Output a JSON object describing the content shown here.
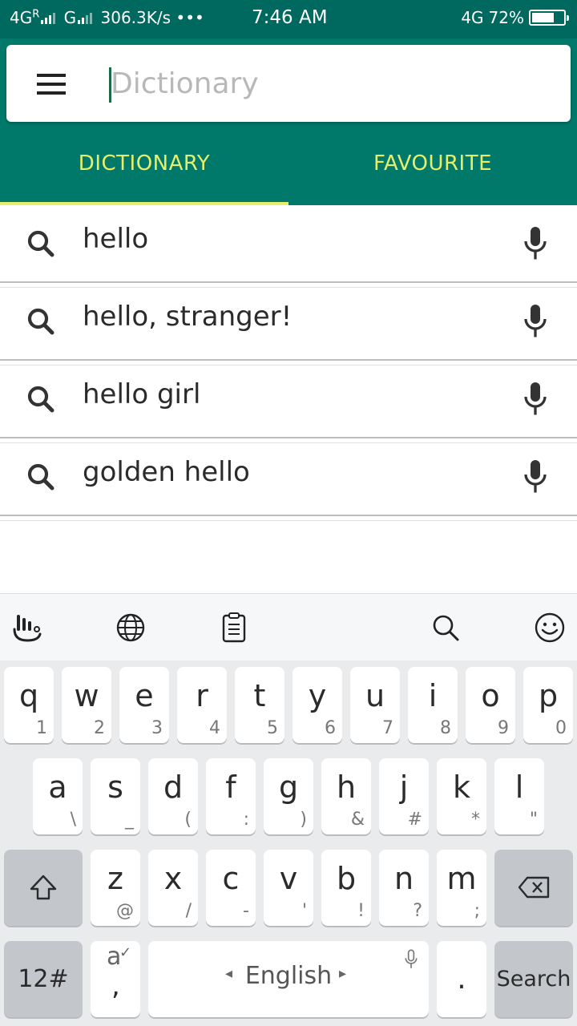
{
  "status_bar": {
    "network_left": "4G",
    "roaming": "R",
    "network_second": "G",
    "speed": "306.3K/s",
    "dots": "•••",
    "time": "7:46 AM",
    "network_right": "4G",
    "battery": "72%"
  },
  "search": {
    "placeholder": "Dictionary",
    "value": ""
  },
  "tabs": [
    {
      "label": "DICTIONARY",
      "active": true
    },
    {
      "label": "FAVOURITE",
      "active": false
    }
  ],
  "suggestions": [
    {
      "text": "hello"
    },
    {
      "text": "hello, stranger!"
    },
    {
      "text": "hello girl"
    },
    {
      "text": "golden hello"
    }
  ],
  "keyboard": {
    "toolbar_icons": [
      "touchpal-icon",
      "globe-icon",
      "clipboard-icon",
      "search-icon",
      "emoji-icon"
    ],
    "row1": [
      {
        "main": "q",
        "sub": "1"
      },
      {
        "main": "w",
        "sub": "2"
      },
      {
        "main": "e",
        "sub": "3"
      },
      {
        "main": "r",
        "sub": "4"
      },
      {
        "main": "t",
        "sub": "5"
      },
      {
        "main": "y",
        "sub": "6"
      },
      {
        "main": "u",
        "sub": "7"
      },
      {
        "main": "i",
        "sub": "8"
      },
      {
        "main": "o",
        "sub": "9"
      },
      {
        "main": "p",
        "sub": "0"
      }
    ],
    "row2": [
      {
        "main": "a",
        "sub": "\\"
      },
      {
        "main": "s",
        "sub": "_"
      },
      {
        "main": "d",
        "sub": "("
      },
      {
        "main": "f",
        "sub": ":"
      },
      {
        "main": "g",
        "sub": ")"
      },
      {
        "main": "h",
        "sub": "&"
      },
      {
        "main": "j",
        "sub": "#"
      },
      {
        "main": "k",
        "sub": "*"
      },
      {
        "main": "l",
        "sub": "\""
      }
    ],
    "row3": [
      {
        "main": "z",
        "sub": "@"
      },
      {
        "main": "x",
        "sub": "/"
      },
      {
        "main": "c",
        "sub": "-"
      },
      {
        "main": "v",
        "sub": "'"
      },
      {
        "main": "b",
        "sub": "!"
      },
      {
        "main": "n",
        "sub": "?"
      },
      {
        "main": "m",
        "sub": ";"
      }
    ],
    "symbols_label": "12#",
    "comma_top": "a",
    "comma_bottom": ",",
    "language_label": "English",
    "period_label": ".",
    "search_label": "Search"
  },
  "colors": {
    "status_bar": "#00695f",
    "header": "#00796b",
    "tab_text": "#e6ee6a",
    "indicator": "#e6ee6a"
  }
}
